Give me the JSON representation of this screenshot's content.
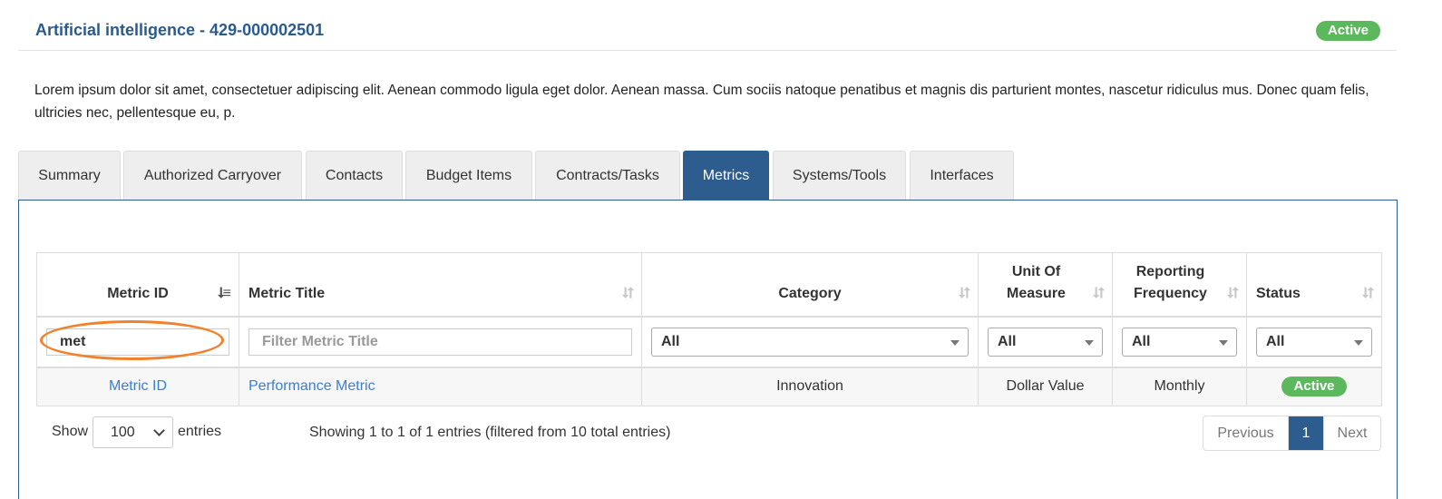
{
  "header": {
    "title": "Artificial intelligence - 429-000002501",
    "status": "Active"
  },
  "description": "Lorem ipsum dolor sit amet, consectetuer adipiscing elit. Aenean commodo ligula eget dolor. Aenean massa. Cum sociis natoque penatibus et magnis dis parturient montes, nascetur ridiculus mus. Donec quam felis, ultricies nec, pellentesque eu, p.",
  "tabs": [
    {
      "label": "Summary",
      "active": false
    },
    {
      "label": "Authorized Carryover",
      "active": false
    },
    {
      "label": "Contacts",
      "active": false
    },
    {
      "label": "Budget Items",
      "active": false
    },
    {
      "label": "Contracts/Tasks",
      "active": false
    },
    {
      "label": "Metrics",
      "active": true
    },
    {
      "label": "Systems/Tools",
      "active": false
    },
    {
      "label": "Interfaces",
      "active": false
    }
  ],
  "table": {
    "columns": [
      {
        "label": "Metric ID",
        "sort": "sorted-asc"
      },
      {
        "label": "Metric Title",
        "sort": "unsorted"
      },
      {
        "label": "Category",
        "sort": "unsorted"
      },
      {
        "label": "Unit Of Measure",
        "sort": "unsorted"
      },
      {
        "label": "Reporting Frequency",
        "sort": "unsorted"
      },
      {
        "label": "Status",
        "sort": "unsorted"
      }
    ],
    "filters": {
      "metric_id_value": "met",
      "metric_title_placeholder": "Filter Metric Title",
      "category": "All",
      "unit": "All",
      "frequency": "All",
      "status": "All"
    },
    "rows": [
      {
        "metric_id": "Metric ID",
        "metric_title": "Performance Metric",
        "category": "Innovation",
        "unit": "Dollar Value",
        "frequency": "Monthly",
        "status": "Active"
      }
    ]
  },
  "footer": {
    "show_label": "Show",
    "page_length": "100",
    "entries_label": "entries",
    "info": "Showing 1 to 1 of 1 entries (filtered from 10 total entries)",
    "pagination": {
      "previous": "Previous",
      "current": "1",
      "next": "Next"
    }
  },
  "colors": {
    "title": "#2b5a8f",
    "active_tab": "#2d5c8f",
    "status_active": "#5cb85c",
    "link": "#3a7ed1",
    "annotation": "#f0822e"
  },
  "icons": {
    "sort_sorted": "sort-amount-asc-icon",
    "sort_unsorted": "sort-both-icon",
    "select_caret": "caret-down-icon",
    "length_chevron": "chevron-down-icon"
  }
}
